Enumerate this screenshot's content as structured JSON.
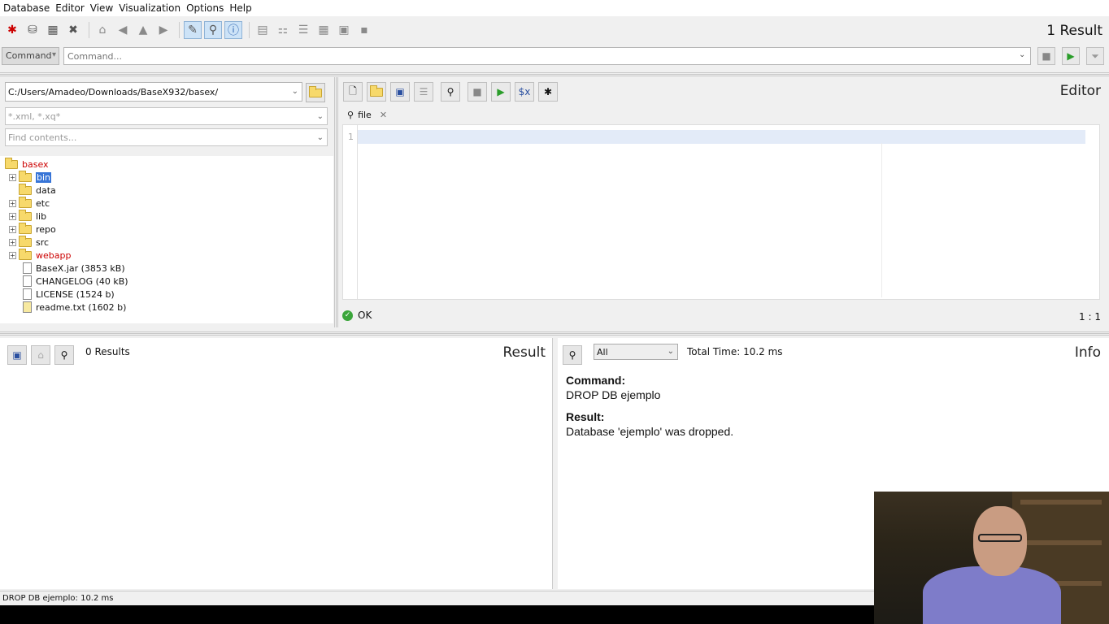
{
  "menu": [
    "Database",
    "Editor",
    "View",
    "Visualization",
    "Options",
    "Help"
  ],
  "header": {
    "result_count": "1 Result"
  },
  "command_bar": {
    "mode": "Command",
    "placeholder": "Command..."
  },
  "project": {
    "path": "C:/Users/Amadeo/Downloads/BaseX932/basex/",
    "filter_placeholder": "*.xml, *.xq*",
    "find_placeholder": "Find contents...",
    "tree": [
      {
        "label": "basex",
        "type": "folder",
        "red": true
      },
      {
        "label": "bin",
        "type": "folder",
        "expandable": true,
        "selected": true
      },
      {
        "label": "data",
        "type": "folder"
      },
      {
        "label": "etc",
        "type": "folder",
        "expandable": true
      },
      {
        "label": "lib",
        "type": "folder",
        "expandable": true
      },
      {
        "label": "repo",
        "type": "folder",
        "expandable": true
      },
      {
        "label": "src",
        "type": "folder",
        "expandable": true
      },
      {
        "label": "webapp",
        "type": "folder",
        "expandable": true,
        "red": true
      },
      {
        "label": "BaseX.jar (3853 kB)",
        "type": "file"
      },
      {
        "label": "CHANGELOG (40 kB)",
        "type": "file"
      },
      {
        "label": "LICENSE (1524 b)",
        "type": "file"
      },
      {
        "label": "readme.txt (1602 b)",
        "type": "file"
      }
    ]
  },
  "editor": {
    "title": "Editor",
    "tab_label": "file",
    "line_number": "1",
    "status": "OK",
    "cursor": "1 : 1",
    "var_button": "$x"
  },
  "result": {
    "title": "Result",
    "count": "0 Results"
  },
  "info": {
    "title": "Info",
    "filter_value": "All",
    "total_time": "Total Time: 10.2 ms",
    "command_label": "Command:",
    "command_value": "DROP DB ejemplo",
    "result_label": "Result:",
    "result_value": "Database 'ejemplo' was dropped."
  },
  "statusbar": {
    "text": "DROP DB ejemplo: 10.2 ms"
  }
}
